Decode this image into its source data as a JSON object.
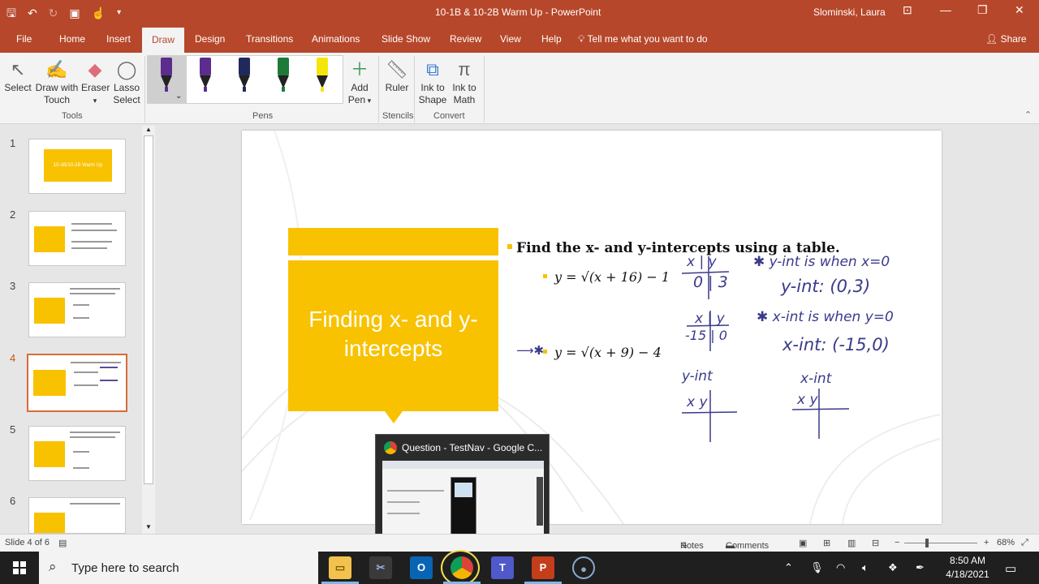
{
  "titlebar": {
    "doc_title": "10-1B & 10-2B Warm Up  -  PowerPoint",
    "user": "Slominski, Laura",
    "qat_icons": [
      "save-icon",
      "undo-icon",
      "redo-icon",
      "present-icon",
      "touch-mode-icon",
      "customize-icon"
    ]
  },
  "tabs": [
    "File",
    "Home",
    "Insert",
    "Draw",
    "Design",
    "Transitions",
    "Animations",
    "Slide Show",
    "Review",
    "View",
    "Help"
  ],
  "active_tab": "Draw",
  "tell_me": "Tell me what you want to do",
  "share": "Share",
  "ribbon": {
    "tools": {
      "select": "Select",
      "draw_touch_1": "Draw with",
      "draw_touch_2": "Touch",
      "eraser": "Eraser",
      "lasso_1": "Lasso",
      "lasso_2": "Select",
      "label": "Tools"
    },
    "pens": {
      "label": "Pens",
      "colors": [
        "#5b2d8e",
        "#5b2d8e",
        "#1f2a5c",
        "#1e7a3a",
        "#f5e60a"
      ]
    },
    "add_pen_1": "Add",
    "add_pen_2": "Pen",
    "ruler": "Ruler",
    "stencils_label": "Stencils",
    "ink_shape_1": "Ink to",
    "ink_shape_2": "Shape",
    "ink_math_1": "Ink to",
    "ink_math_2": "Math",
    "convert_label": "Convert"
  },
  "thumbnails": {
    "numbers": [
      "1",
      "2",
      "3",
      "4",
      "5",
      "6"
    ],
    "active": 4,
    "slide1_title": "10-1B/10-2B Warm Up"
  },
  "slide": {
    "title": "Finding x- and y-intercepts",
    "bullet": "Find the x- and y-intercepts using a table.",
    "eq1": "y = √(x + 16) − 1",
    "eq2": "y = √(x + 9) − 4",
    "ink": {
      "t1_head": "x | y",
      "t1_row": "0 | 3",
      "t2_head": "x | y",
      "t2_row": "-15 | 0",
      "note1": "✱ y-int is when x=0",
      "note2": "y-int: (0,3)",
      "note3": "✱ x-int is when y=0",
      "note4": "x-int: (-15,0)",
      "yint_label": "y-int",
      "xint_label": "x-int",
      "xy1": "x   y",
      "xy2": "x   y",
      "arrow": "⟶✱"
    }
  },
  "preview": {
    "title": "Question - TestNav - Google C..."
  },
  "status": {
    "slide_of": "Slide 4 of 6",
    "notes": "Notes",
    "comments": "Comments",
    "zoom": "68%"
  },
  "taskbar": {
    "search_placeholder": "Type here to search",
    "time": "8:50 AM",
    "date": "4/18/2021"
  }
}
